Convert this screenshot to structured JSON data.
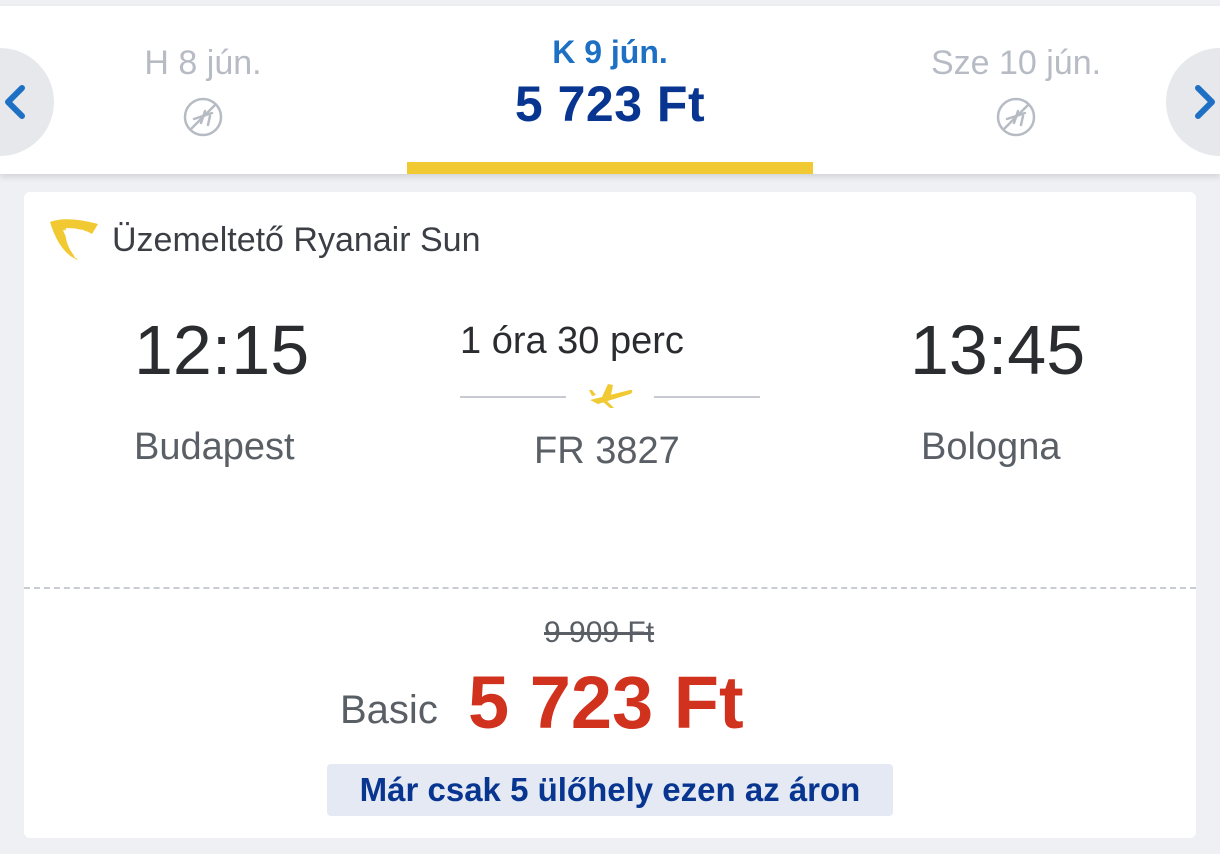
{
  "date_strip": {
    "prev": {
      "label": "H 8 jún.",
      "icon": "no-flights-icon"
    },
    "active": {
      "label": "K 9 jún.",
      "price": "5 723 Ft"
    },
    "next": {
      "label": "Sze 10 jún.",
      "icon": "no-flights-icon"
    },
    "prev_button_icon": "chevron-left-icon",
    "next_button_icon": "chevron-right-icon"
  },
  "flight": {
    "operator": "Üzemeltető Ryanair Sun",
    "departure_time": "12:15",
    "departure_city": "Budapest",
    "arrival_time": "13:45",
    "arrival_city": "Bologna",
    "duration": "1 óra 30 perc",
    "flight_number": "FR 3827"
  },
  "fare": {
    "old_price": "9 909 Ft",
    "name": "Basic",
    "price": "5 723 Ft",
    "seats_notice": "Már csak 5 ülőhely ezen az áron"
  },
  "colors": {
    "brand_blue": "#073590",
    "accent_yellow": "#f1c933",
    "price_red": "#d0321e",
    "link_blue": "#1d70c4"
  }
}
